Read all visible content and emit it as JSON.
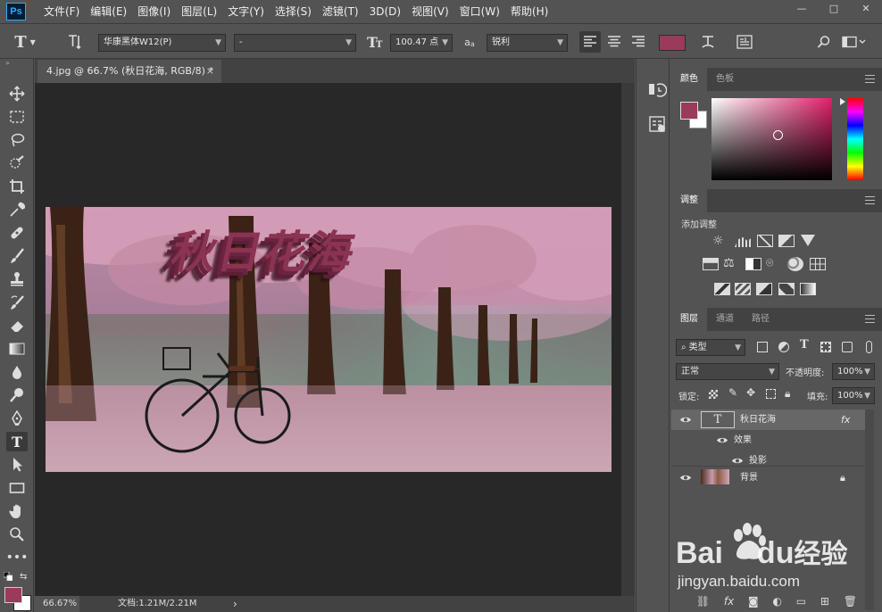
{
  "app": {
    "logo": "Ps"
  },
  "menu": [
    "文件(F)",
    "编辑(E)",
    "图像(I)",
    "图层(L)",
    "文字(Y)",
    "选择(S)",
    "滤镜(T)",
    "3D(D)",
    "视图(V)",
    "窗口(W)",
    "帮助(H)"
  ],
  "window_controls": {
    "minimize": "—",
    "restore": "□",
    "close": "✕"
  },
  "options": {
    "tool_glyph": "T",
    "font_family": "华康黑体W12(P)",
    "font_style": "-",
    "font_size": "100.47 点",
    "aa_label": "a",
    "aa_sub": "a",
    "antialias": "锐利",
    "color": "#9b3a5a"
  },
  "document": {
    "tab_title": "4.jpg @ 66.7% (秋日花海, RGB/8) *",
    "close_glyph": "×",
    "overlay_text": "秋日花海",
    "zoom": "66.67%",
    "doc_size": "文档:1.21M/2.21M",
    "status_arrow": "›"
  },
  "colors": {
    "foreground": "#9b3a5a",
    "background": "#ffffff",
    "accent": "#31a8ff"
  },
  "panels": {
    "color_tabs": [
      "颜色",
      "色板"
    ],
    "adjust_tab": "调整",
    "adjust_add": "添加调整",
    "layers_tabs": [
      "图层",
      "通道",
      "路径"
    ],
    "filter_kind": "类型",
    "blend_mode": "正常",
    "opacity_label": "不透明度:",
    "opacity_value": "100%",
    "lock_label": "锁定:",
    "fill_label": "填充:",
    "fill_value": "100%",
    "layers": [
      {
        "name": "秋日花海",
        "fx": "fx"
      },
      {
        "name": "效果"
      },
      {
        "name": "投影"
      },
      {
        "name": "背景"
      }
    ]
  },
  "watermark": {
    "brand": "Bai",
    "brand_mid": "du",
    "cn": "经验",
    "url": "jingyan.baidu.com"
  },
  "icons": [
    "move-icon",
    "marquee-icon",
    "lasso-icon",
    "quick-select-icon",
    "crop-icon",
    "eyedropper-icon",
    "healing-icon",
    "brush-icon",
    "stamp-icon",
    "history-brush-icon",
    "eraser-icon",
    "gradient-icon",
    "blur-icon",
    "dodge-icon",
    "pen-icon",
    "type-icon",
    "path-select-icon",
    "rectangle-icon",
    "hand-icon",
    "zoom-icon",
    "more-icon"
  ]
}
